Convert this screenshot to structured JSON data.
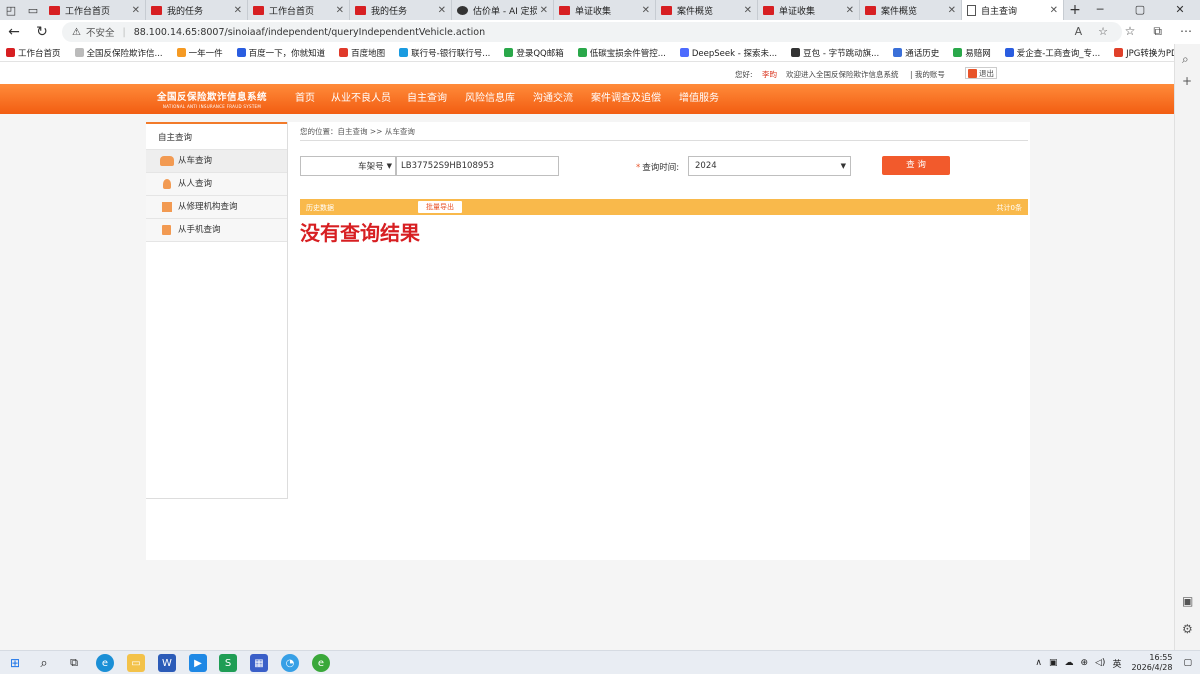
{
  "browser": {
    "tabs": [
      {
        "label": "工作台首页",
        "icon": "red"
      },
      {
        "label": "我的任务",
        "icon": "red"
      },
      {
        "label": "工作台首页",
        "icon": "red"
      },
      {
        "label": "我的任务",
        "icon": "red"
      },
      {
        "label": "估价单 - AI 定损",
        "icon": "dark"
      },
      {
        "label": "单证收集",
        "icon": "red"
      },
      {
        "label": "案件概览",
        "icon": "red"
      },
      {
        "label": "单证收集",
        "icon": "red"
      },
      {
        "label": "案件概览",
        "icon": "red"
      },
      {
        "label": "自主查询",
        "icon": "doc",
        "active": true
      }
    ],
    "security_label": "不安全",
    "url": "88.100.14.65:8007/sinoiaaf/independent/queryIndependentVehicle.action",
    "bookmarks": [
      {
        "label": "工作台首页",
        "color": "#d71f22"
      },
      {
        "label": "全国反保险欺诈信...",
        "color": "#bbbbbb"
      },
      {
        "label": "一年一件",
        "color": "#f59a23"
      },
      {
        "label": "百度一下，你就知道",
        "color": "#2a5de0"
      },
      {
        "label": "百度地图",
        "color": "#e03a2a"
      },
      {
        "label": "联行号-银行联行号...",
        "color": "#1a9be0"
      },
      {
        "label": "登录QQ邮箱",
        "color": "#2aa84a"
      },
      {
        "label": "低碳宝损余件管控...",
        "color": "#2aa84a"
      },
      {
        "label": "DeepSeek - 探索未...",
        "color": "#4d6bfe"
      },
      {
        "label": "豆包 - 字节跳动旗...",
        "color": "#333333"
      },
      {
        "label": "通话历史",
        "color": "#3a6fd8"
      },
      {
        "label": "易赔网",
        "color": "#2aa84a"
      },
      {
        "label": "爱企查-工商查询_专...",
        "color": "#2a5de0"
      },
      {
        "label": "JPG转换为PDF文件...",
        "color": "#e0402a"
      }
    ]
  },
  "site": {
    "userbar": {
      "greeting": "您好:",
      "username": "李昀",
      "welcome": "欢迎进入全国反保险欺诈信息系统",
      "account": "| 我的账号",
      "logout": "退出"
    },
    "logo": {
      "title": "全国反保险欺诈信息系统",
      "subtitle": "NATIONAL ANTI INSURANCE FRAUD SYSTEM"
    },
    "menu": [
      "首页",
      "从业不良人员",
      "自主查询",
      "风险信息库",
      "沟通交流",
      "案件调查及追偿",
      "增值服务"
    ],
    "sidebar": {
      "title": "自主查询",
      "items": [
        {
          "label": "从车查询",
          "icon": "car",
          "active": true
        },
        {
          "label": "从人查询",
          "icon": "person"
        },
        {
          "label": "从修理机构查询",
          "icon": "build"
        },
        {
          "label": "从手机查询",
          "icon": "phone"
        }
      ]
    },
    "breadcrumb": "您的位置：自主查询 >> 从车查询",
    "form": {
      "type_selected": "车架号",
      "vin_value": "LB37752S9HB108953",
      "time_label": "查询时间:",
      "year_selected": "2024",
      "query_button": "查 询"
    },
    "result": {
      "history_label": "历史数据",
      "export_button": "批量导出",
      "total": "共计0条",
      "empty_message": "没有查询结果"
    }
  },
  "taskbar": {
    "lang": "英",
    "time": "16:55",
    "date": "2026/4/28"
  }
}
